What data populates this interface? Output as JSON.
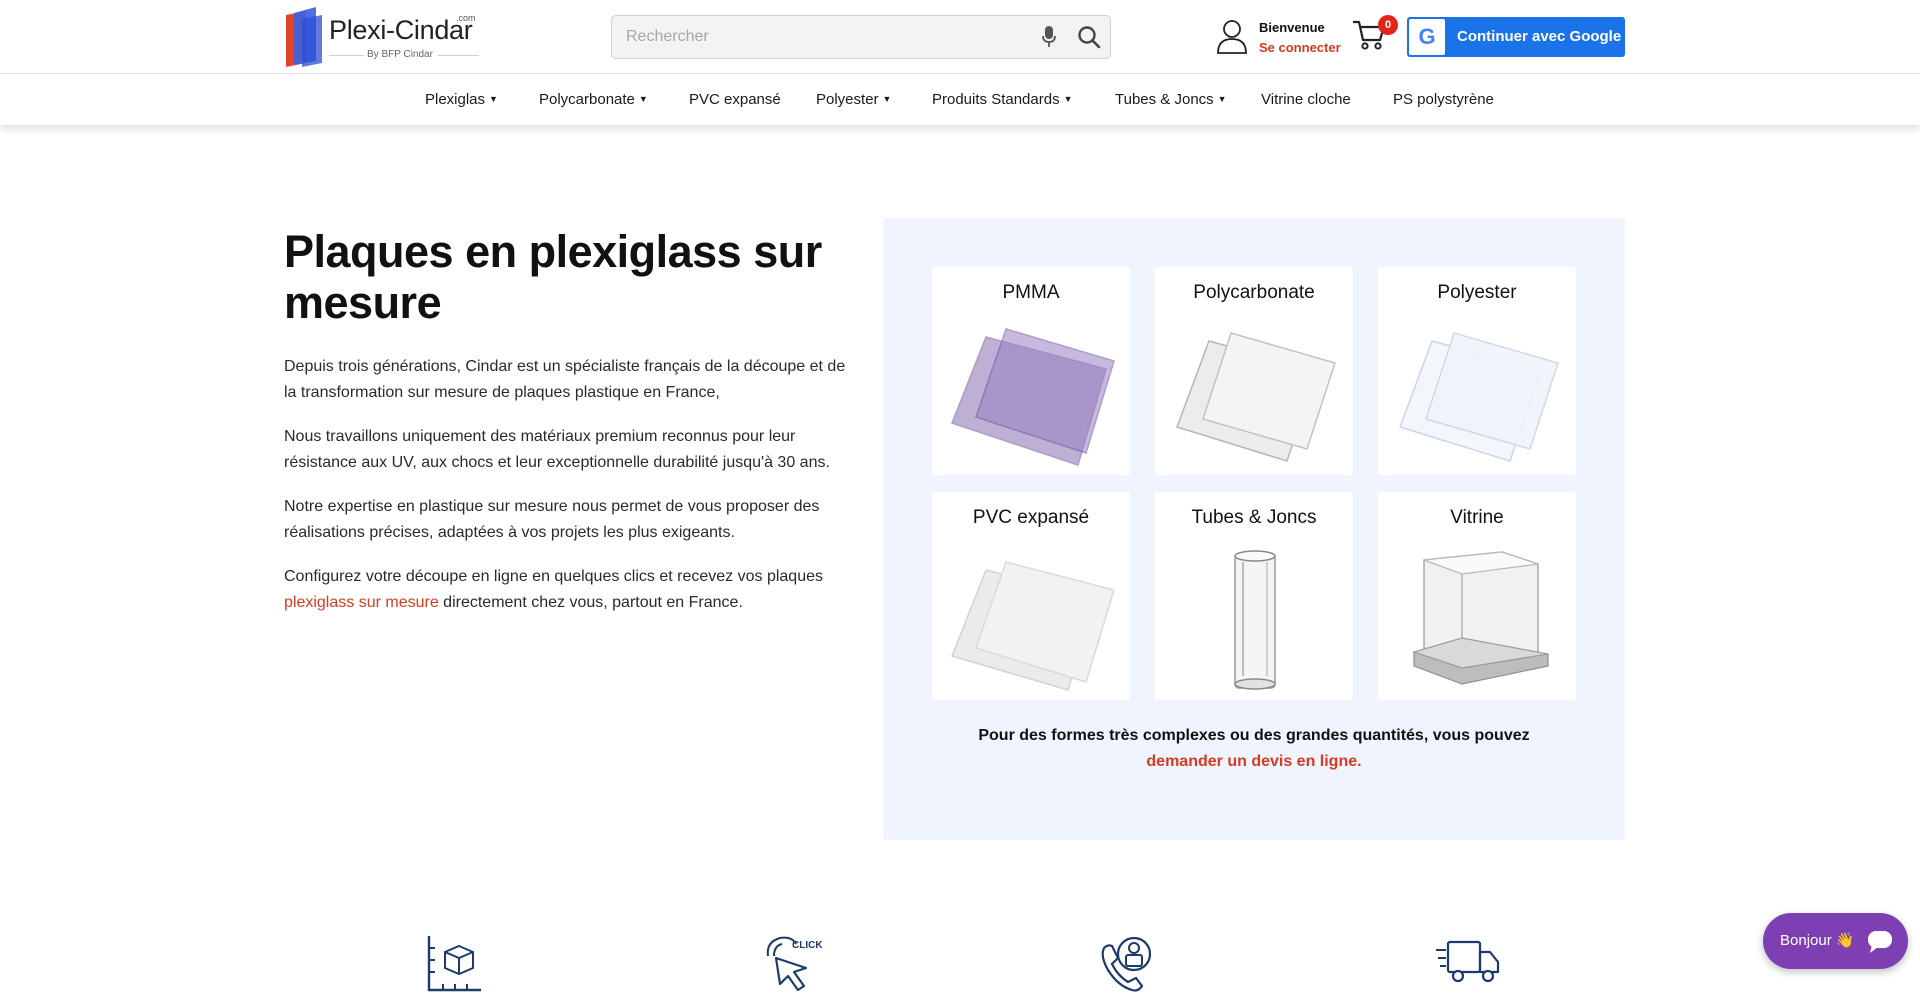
{
  "header": {
    "logo_brand": "Plexi-Cindar",
    "logo_suffix": ".com",
    "logo_byline": "By BFP Cindar",
    "search_placeholder": "Rechercher",
    "welcome": "Bienvenue",
    "login": "Se connecter",
    "cart_count": "0",
    "google_button": "Continuer avec Google"
  },
  "nav": {
    "items": [
      {
        "label": "Plexiglas",
        "dropdown": true
      },
      {
        "label": "Polycarbonate",
        "dropdown": true
      },
      {
        "label": "PVC expansé",
        "dropdown": false
      },
      {
        "label": "Polyester",
        "dropdown": true
      },
      {
        "label": "Produits Standards",
        "dropdown": true
      },
      {
        "label": "Tubes & Joncs",
        "dropdown": true
      },
      {
        "label": "Vitrine cloche",
        "dropdown": false
      },
      {
        "label": "PS polystyrène",
        "dropdown": false
      }
    ]
  },
  "intro": {
    "title": "Plaques en plexiglass sur mesure",
    "p1": "Depuis trois générations, Cindar est un spécialiste français de la découpe et de la transformation sur mesure de plaques plastique en France,",
    "p2": "Nous travaillons uniquement des matériaux premium reconnus pour leur résistance aux UV, aux chocs et leur exceptionnelle durabilité jusqu'à 30 ans.",
    "p3": "Notre expertise en plastique sur mesure nous permet de vous proposer des réalisations précises, adaptées à vos projets les plus exigeants.",
    "p4_before": "Configurez votre découpe en ligne en quelques clics et recevez vos plaques ",
    "p4_link": "plexiglass sur mesure",
    "p4_after": " directement chez vous, partout en France."
  },
  "materials": {
    "cards": [
      {
        "title": "PMMA",
        "icon": "purple-sheets-image"
      },
      {
        "title": "Polycarbonate",
        "icon": "white-sheets-image"
      },
      {
        "title": "Polyester",
        "icon": "clear-sheets-image"
      },
      {
        "title": "PVC expansé",
        "icon": "white-pvc-sheets-image"
      },
      {
        "title": "Tubes & Joncs",
        "icon": "clear-tube-image"
      },
      {
        "title": "Vitrine",
        "icon": "display-case-image"
      }
    ],
    "quote_before": "Pour des formes très complexes ou des grandes quantités, vous pouvez ",
    "quote_link": "demander un devis en ligne."
  },
  "features": {
    "icons": [
      "measure-box-icon",
      "click-cursor-icon",
      "phone-support-icon",
      "delivery-truck-icon"
    ]
  },
  "chat": {
    "label": "Bonjour 👋"
  },
  "colors": {
    "accent_red": "#d63b1f",
    "google_blue": "#1a73e8",
    "panel_bg": "#f0f4ff",
    "chat_purple": "#7e3fb3",
    "icon_navy": "#1d3a6b"
  }
}
